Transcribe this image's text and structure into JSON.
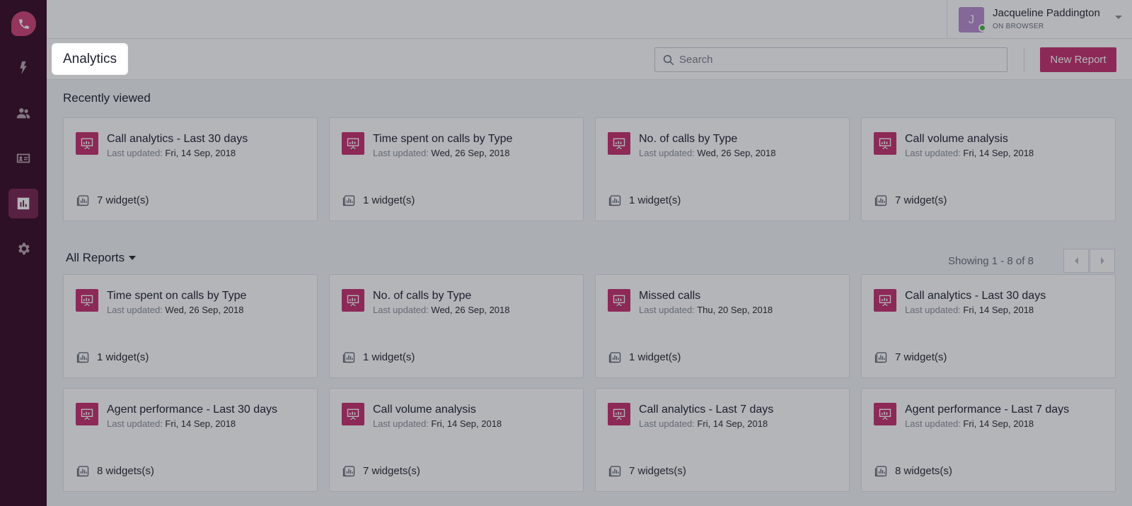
{
  "sidebar": {
    "logo_icon": "phone-icon",
    "items": [
      {
        "name": "lightning-icon",
        "active": false
      },
      {
        "name": "people-icon",
        "active": false
      },
      {
        "name": "contact-card-icon",
        "active": false
      },
      {
        "name": "analytics-icon",
        "active": true
      },
      {
        "name": "gear-icon",
        "active": false
      }
    ]
  },
  "user": {
    "initial": "J",
    "name": "Jacqueline Paddington",
    "status": "ON BROWSER"
  },
  "header": {
    "title": "Analytics",
    "search_placeholder": "Search",
    "new_report_label": "New Report"
  },
  "recent": {
    "title": "Recently viewed",
    "cards": [
      {
        "title": "Call analytics - Last 30 days",
        "updated_label": "Last updated:",
        "updated": "Fri, 14 Sep, 2018",
        "widgets": "7 widget(s)"
      },
      {
        "title": "Time spent on calls by Type",
        "updated_label": "Last updated:",
        "updated": "Wed, 26 Sep, 2018",
        "widgets": "1 widget(s)"
      },
      {
        "title": "No. of calls by Type",
        "updated_label": "Last updated:",
        "updated": "Wed, 26 Sep, 2018",
        "widgets": "1 widget(s)"
      },
      {
        "title": "Call volume analysis",
        "updated_label": "Last updated:",
        "updated": "Fri, 14 Sep, 2018",
        "widgets": "7 widget(s)"
      }
    ]
  },
  "all_reports": {
    "title": "All Reports",
    "showing": "Showing 1 - 8 of 8",
    "cards": [
      {
        "title": "Time spent on calls by Type",
        "updated_label": "Last updated:",
        "updated": "Wed, 26 Sep, 2018",
        "widgets": "1 widget(s)"
      },
      {
        "title": "No. of calls by Type",
        "updated_label": "Last updated:",
        "updated": "Wed, 26 Sep, 2018",
        "widgets": "1 widget(s)"
      },
      {
        "title": "Missed calls",
        "updated_label": "Last updated:",
        "updated": "Thu, 20 Sep, 2018",
        "widgets": "1 widget(s)"
      },
      {
        "title": "Call analytics - Last 30 days",
        "updated_label": "Last updated:",
        "updated": "Fri, 14 Sep, 2018",
        "widgets": "7 widget(s)"
      },
      {
        "title": "Agent performance - Last 30 days",
        "updated_label": "Last updated:",
        "updated": "Fri, 14 Sep, 2018",
        "widgets": "8 widgets(s)"
      },
      {
        "title": "Call volume analysis",
        "updated_label": "Last updated:",
        "updated": "Fri, 14 Sep, 2018",
        "widgets": "7 widgets(s)"
      },
      {
        "title": "Call analytics - Last 7 days",
        "updated_label": "Last updated:",
        "updated": "Fri, 14 Sep, 2018",
        "widgets": "7 widgets(s)"
      },
      {
        "title": "Agent performance - Last 7 days",
        "updated_label": "Last updated:",
        "updated": "Fri, 14 Sep, 2018",
        "widgets": "8 widgets(s)"
      }
    ]
  },
  "colors": {
    "sidebar_bg": "#3a0d26",
    "accent": "#c8326f",
    "nav_active": "#7a2550"
  }
}
